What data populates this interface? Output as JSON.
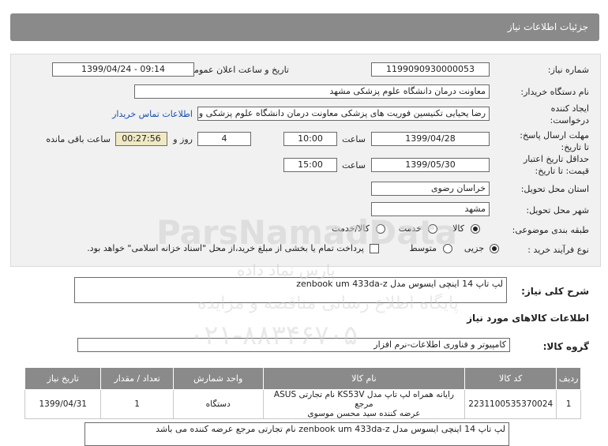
{
  "header": {
    "title": "جزئیات اطلاعات نیاز"
  },
  "form": {
    "need_number": {
      "label": "شماره نیاز:",
      "value": "1199090930000053"
    },
    "announce": {
      "label": "تاریخ و ساعت اعلان عمومی:",
      "value": "1399/04/24 - 09:14"
    },
    "buyer_org": {
      "label": "نام دستگاه خریدار:",
      "value": "معاونت درمان دانشگاه علوم پزشکی مشهد"
    },
    "creator": {
      "label_1": "ایجاد کننده",
      "label_2": "درخواست:",
      "value": "رضا یحیایی تکنیسین فوریت های پزشکی معاونت درمان دانشگاه علوم پزشکی و",
      "contact_link": "اطلاعات تماس خریدار"
    },
    "reply_deadline": {
      "label_1": "مهلت ارسال پاسخ:",
      "label_2": "تا تاریخ:",
      "date": "1399/04/28",
      "time_label": "ساعت",
      "time": "10:00",
      "days": "4",
      "days_label": "روز و",
      "remaining": "00:27:56",
      "remaining_label": "ساعت باقی مانده"
    },
    "price_validity": {
      "label_1": "حداقل تاریخ اعتبار",
      "label_2": "قیمت: تا تاریخ:",
      "date": "1399/05/30",
      "time_label": "ساعت",
      "time": "15:00"
    },
    "province": {
      "label": "استان محل تحویل:",
      "value": "خراسان رضوی"
    },
    "city": {
      "label": "شهر محل تحویل:",
      "value": "مشهد"
    },
    "category": {
      "label": "طبقه بندی موضوعی:",
      "options": [
        "کالا",
        "خدمت",
        "کالا/خدمت"
      ],
      "selected": "کالا"
    },
    "purchase_process": {
      "label": "نوع فرآیند خرید :",
      "options": [
        "جزیی",
        "متوسط"
      ],
      "selected": "جزیی",
      "checkbox_text": "پرداخت تمام یا بخشی از مبلغ خرید،از محل \"اسناد خزانه اسلامی\" خواهد بود."
    }
  },
  "summary": {
    "label": "شرح کلی نیاز:",
    "value": "لپ تاپ 14 اینچی ایسوس مدل zenbook um 433da-z"
  },
  "goods_section": {
    "title": "اطلاعات کالاهای مورد نیاز"
  },
  "goods_group": {
    "label": "گروه کالا:",
    "value": "کامپیوتر و فناوری اطلاعات-نرم افزار"
  },
  "table": {
    "headers": [
      "ردیف",
      "کد کالا",
      "نام کالا",
      "واحد شمارش",
      "تعداد / مقدار",
      "تاریخ نیاز"
    ],
    "rows": [
      {
        "row": "1",
        "code": "2231100535370024",
        "name_1": "رایانه همراه لپ تاپ مدل KS53V نام تجارتی ASUS مرجع",
        "name_2": "عرضه کننده سید محسن موسوی",
        "unit": "دستگاه",
        "qty": "1",
        "date": "1399/04/31"
      }
    ]
  },
  "bottom_note": "لپ تاپ 14 اینچی ایسوس مدل zenbook um 433da-z نام تجارتی مرجع عرضه کننده می باشد",
  "watermark": {
    "line1": "ParsNamadData",
    "line2": "پارس نماد داده",
    "line3": "پایگاه اطلاع رسانی مناقصه و مزایده",
    "line4": "۰۲۱-۸۸۳۴۶۷۰۵"
  }
}
